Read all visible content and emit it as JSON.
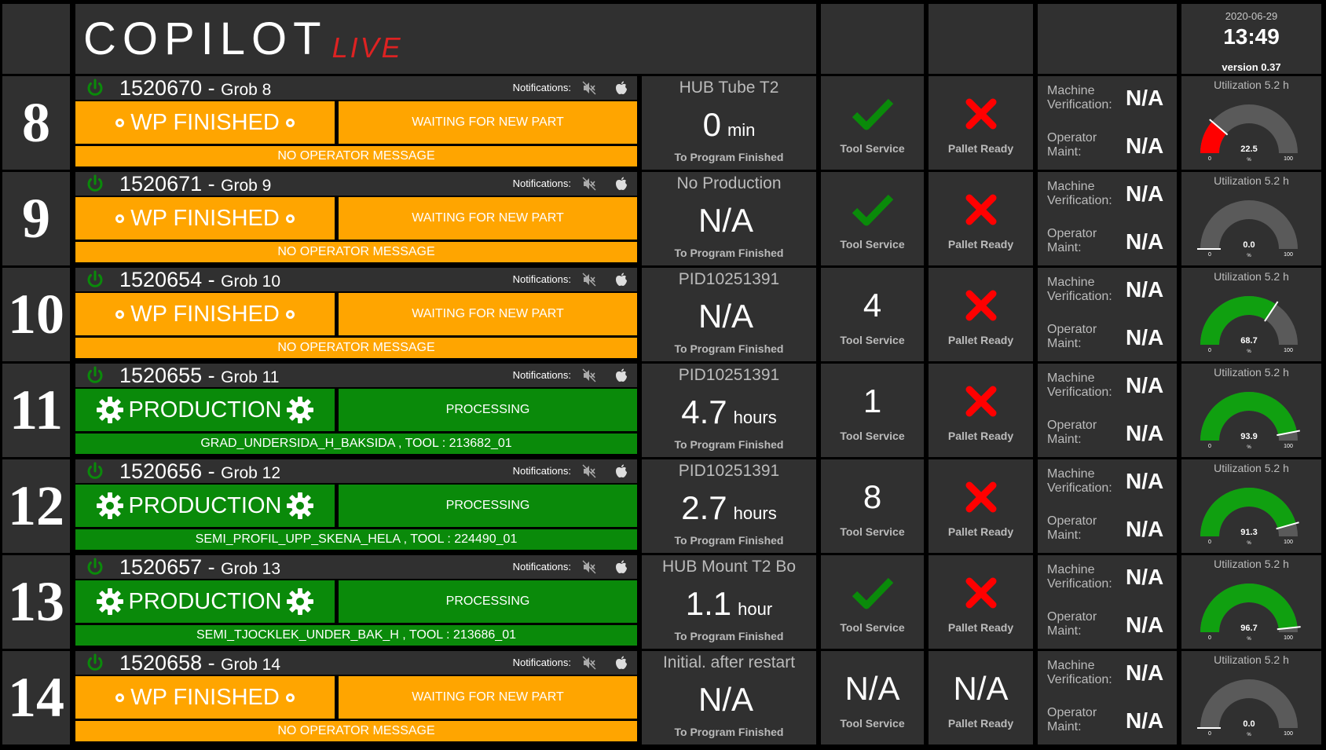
{
  "header": {
    "logo_main": "COPILOT",
    "logo_live": "LIVE",
    "date": "2020-06-29",
    "time": "13:49",
    "version": "version 0.37"
  },
  "colors": {
    "background": "#000000",
    "panel": "#303030",
    "finished": "#ffa500",
    "production": "#0a8a0a",
    "ok": "#0a8a0a",
    "error": "#ff0000",
    "gauge_track": "#5a5a5a",
    "gauge_red": "#ff0000",
    "gauge_green": "#10a010"
  },
  "labels": {
    "notifications": "Notifications:",
    "to_program_finished": "To Program Finished",
    "tool_service": "Tool Service",
    "pallet_ready": "Pallet Ready",
    "machine_verification": "Machine Verification:",
    "operator_maint": "Operator Maint:",
    "utilization": "Utilization 5.2 h",
    "gauge_min": "0",
    "gauge_max": "100",
    "gauge_unit": "%"
  },
  "machines": [
    {
      "number": "8",
      "id": "1520670",
      "name": "Grob 8",
      "status": "WP FINISHED",
      "status_icon": "circle-icon",
      "status_type": "finished",
      "sub_status": "WAITING FOR NEW PART",
      "message": "NO OPERATOR MESSAGE",
      "program": "HUB Tube T2",
      "time_value": "0",
      "time_unit": "min",
      "tool_service": {
        "kind": "check",
        "text": ""
      },
      "pallet_ready": {
        "kind": "cross",
        "text": ""
      },
      "machine_verification": "N/A",
      "operator_maint": "N/A",
      "utilization": 22.5,
      "utilization_label": "22.5"
    },
    {
      "number": "9",
      "id": "1520671",
      "name": "Grob 9",
      "status": "WP FINISHED",
      "status_icon": "circle-icon",
      "status_type": "finished",
      "sub_status": "WAITING FOR NEW PART",
      "message": "NO OPERATOR MESSAGE",
      "program": "No Production",
      "time_value": "N/A",
      "time_unit": "",
      "tool_service": {
        "kind": "check",
        "text": ""
      },
      "pallet_ready": {
        "kind": "cross",
        "text": ""
      },
      "machine_verification": "N/A",
      "operator_maint": "N/A",
      "utilization": 0.0,
      "utilization_label": "0.0"
    },
    {
      "number": "10",
      "id": "1520654",
      "name": "Grob 10",
      "status": "WP FINISHED",
      "status_icon": "circle-icon",
      "status_type": "finished",
      "sub_status": "WAITING FOR NEW PART",
      "message": "NO OPERATOR MESSAGE",
      "program": "PID10251391",
      "time_value": "N/A",
      "time_unit": "",
      "tool_service": {
        "kind": "text",
        "text": "4"
      },
      "pallet_ready": {
        "kind": "cross",
        "text": ""
      },
      "machine_verification": "N/A",
      "operator_maint": "N/A",
      "utilization": 68.7,
      "utilization_label": "68.7"
    },
    {
      "number": "11",
      "id": "1520655",
      "name": "Grob 11",
      "status": "PRODUCTION",
      "status_icon": "gear-icon",
      "status_type": "production",
      "sub_status": "PROCESSING",
      "message": "GRAD_UNDERSIDA_H_BAKSIDA , TOOL : 213682_01",
      "program": "PID10251391",
      "time_value": "4.7",
      "time_unit": "hours",
      "tool_service": {
        "kind": "text",
        "text": "1"
      },
      "pallet_ready": {
        "kind": "cross",
        "text": ""
      },
      "machine_verification": "N/A",
      "operator_maint": "N/A",
      "utilization": 93.9,
      "utilization_label": "93.9"
    },
    {
      "number": "12",
      "id": "1520656",
      "name": "Grob 12",
      "status": "PRODUCTION",
      "status_icon": "gear-icon",
      "status_type": "production",
      "sub_status": "PROCESSING",
      "message": "SEMI_PROFIL_UPP_SKENA_HELA , TOOL : 224490_01",
      "program": "PID10251391",
      "time_value": "2.7",
      "time_unit": "hours",
      "tool_service": {
        "kind": "text",
        "text": "8"
      },
      "pallet_ready": {
        "kind": "cross",
        "text": ""
      },
      "machine_verification": "N/A",
      "operator_maint": "N/A",
      "utilization": 91.3,
      "utilization_label": "91.3"
    },
    {
      "number": "13",
      "id": "1520657",
      "name": "Grob 13",
      "status": "PRODUCTION",
      "status_icon": "gear-icon",
      "status_type": "production",
      "sub_status": "PROCESSING",
      "message": "SEMI_TJOCKLEK_UNDER_BAK_H , TOOL : 213686_01",
      "program": "HUB Mount T2 Bo",
      "time_value": "1.1",
      "time_unit": "hour",
      "tool_service": {
        "kind": "check",
        "text": ""
      },
      "pallet_ready": {
        "kind": "cross",
        "text": ""
      },
      "machine_verification": "N/A",
      "operator_maint": "N/A",
      "utilization": 96.7,
      "utilization_label": "96.7"
    },
    {
      "number": "14",
      "id": "1520658",
      "name": "Grob 14",
      "status": "WP FINISHED",
      "status_icon": "circle-icon",
      "status_type": "finished",
      "sub_status": "WAITING FOR NEW PART",
      "message": "NO OPERATOR MESSAGE",
      "program": "Initial. after restart",
      "time_value": "N/A",
      "time_unit": "",
      "tool_service": {
        "kind": "text",
        "text": "N/A"
      },
      "pallet_ready": {
        "kind": "text",
        "text": "N/A"
      },
      "machine_verification": "N/A",
      "operator_maint": "N/A",
      "utilization": 0.0,
      "utilization_label": "0.0"
    }
  ]
}
